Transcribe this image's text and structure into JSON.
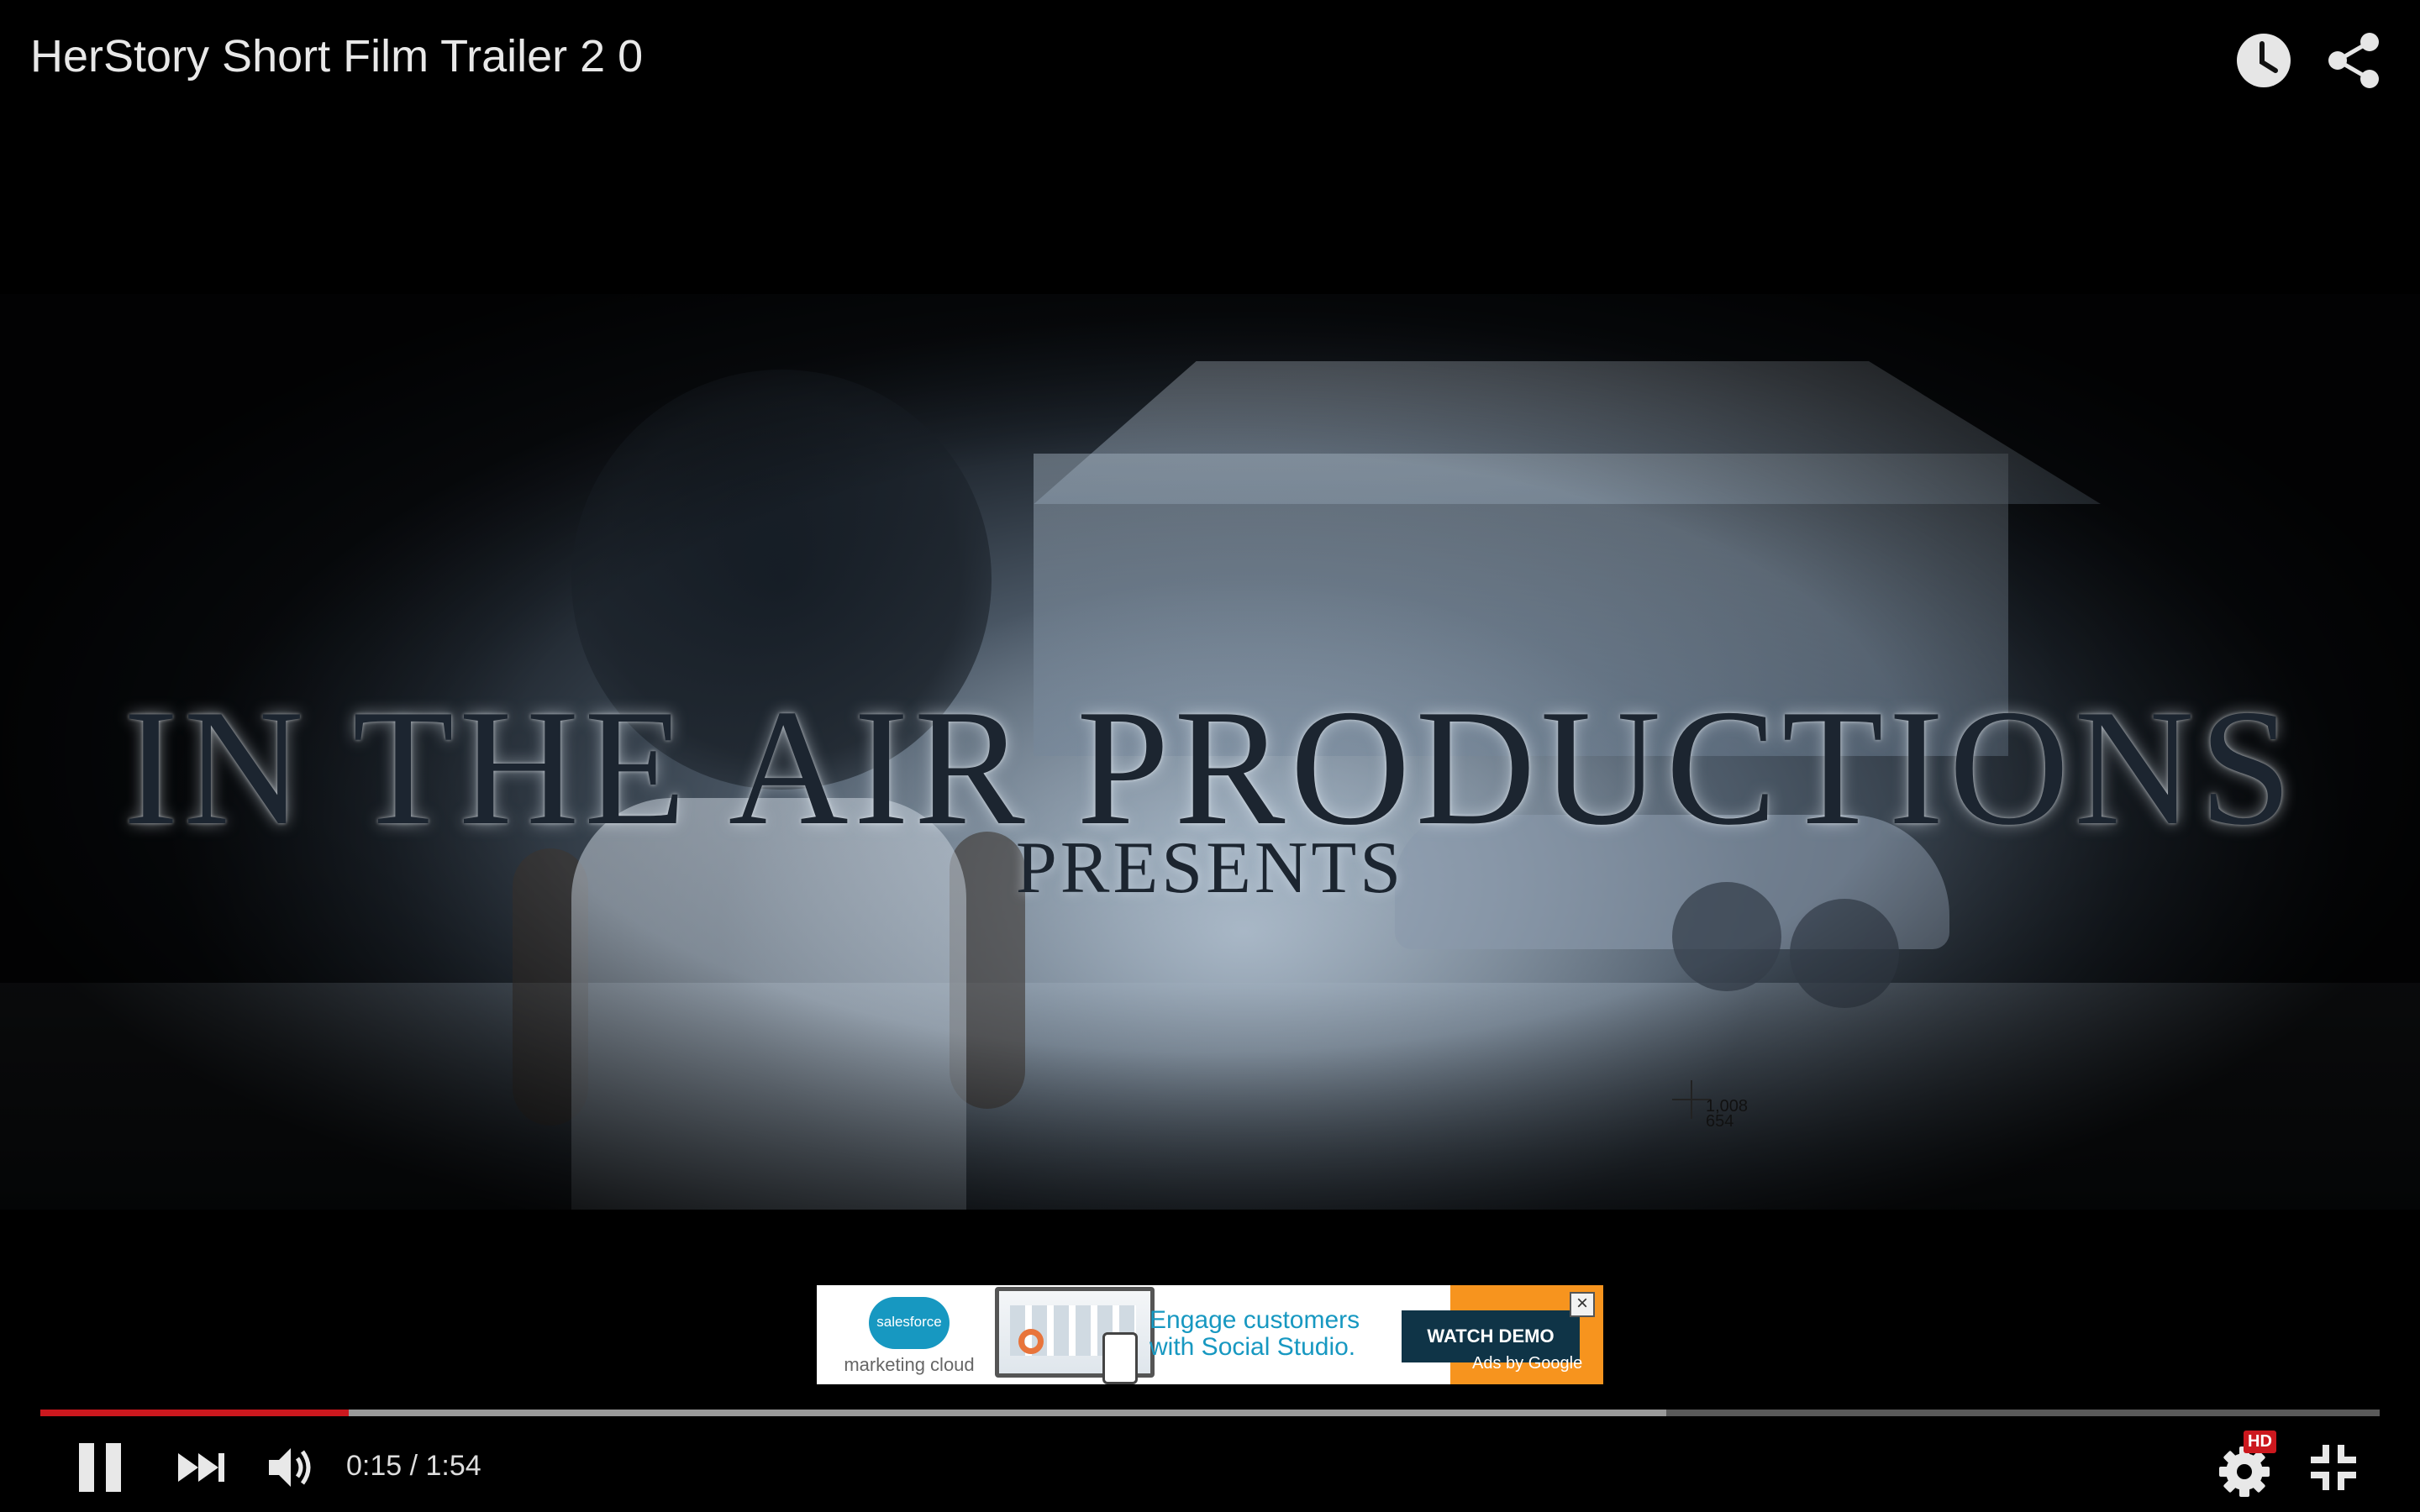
{
  "player": {
    "title": "HerStory Short Film Trailer 2 0",
    "current_time": "0:15",
    "separator": "/",
    "duration": "1:54",
    "time_label": "0:15 / 1:54",
    "played_fraction": 0.132,
    "buffered_fraction": 0.695,
    "quality_badge": "HD",
    "accent_color": "#cc181e",
    "icons": {
      "watch_later": "clock-icon",
      "share": "share-icon",
      "pause": "pause-icon",
      "next": "next-icon",
      "volume": "volume-icon",
      "settings": "gear-icon",
      "exit_fullscreen": "exit-fullscreen-icon"
    }
  },
  "video_frame": {
    "title_text": "IN THE AIR PRODUCTIONS",
    "subtitle_text": "PRESENTS",
    "cursor_coords_line1": "1,008",
    "cursor_coords_line2": "654"
  },
  "ad": {
    "brand_logo_text": "salesforce",
    "brand_subtext": "marketing cloud",
    "headline_line1": "Engage customers",
    "headline_line2": "with Social Studio.",
    "cta_label": "WATCH DEMO",
    "attribution": "Ads by Google",
    "close_glyph": "×",
    "brand_color": "#1798c1",
    "cta_bg_color": "#0f3447",
    "accent_color": "#f7941e"
  }
}
